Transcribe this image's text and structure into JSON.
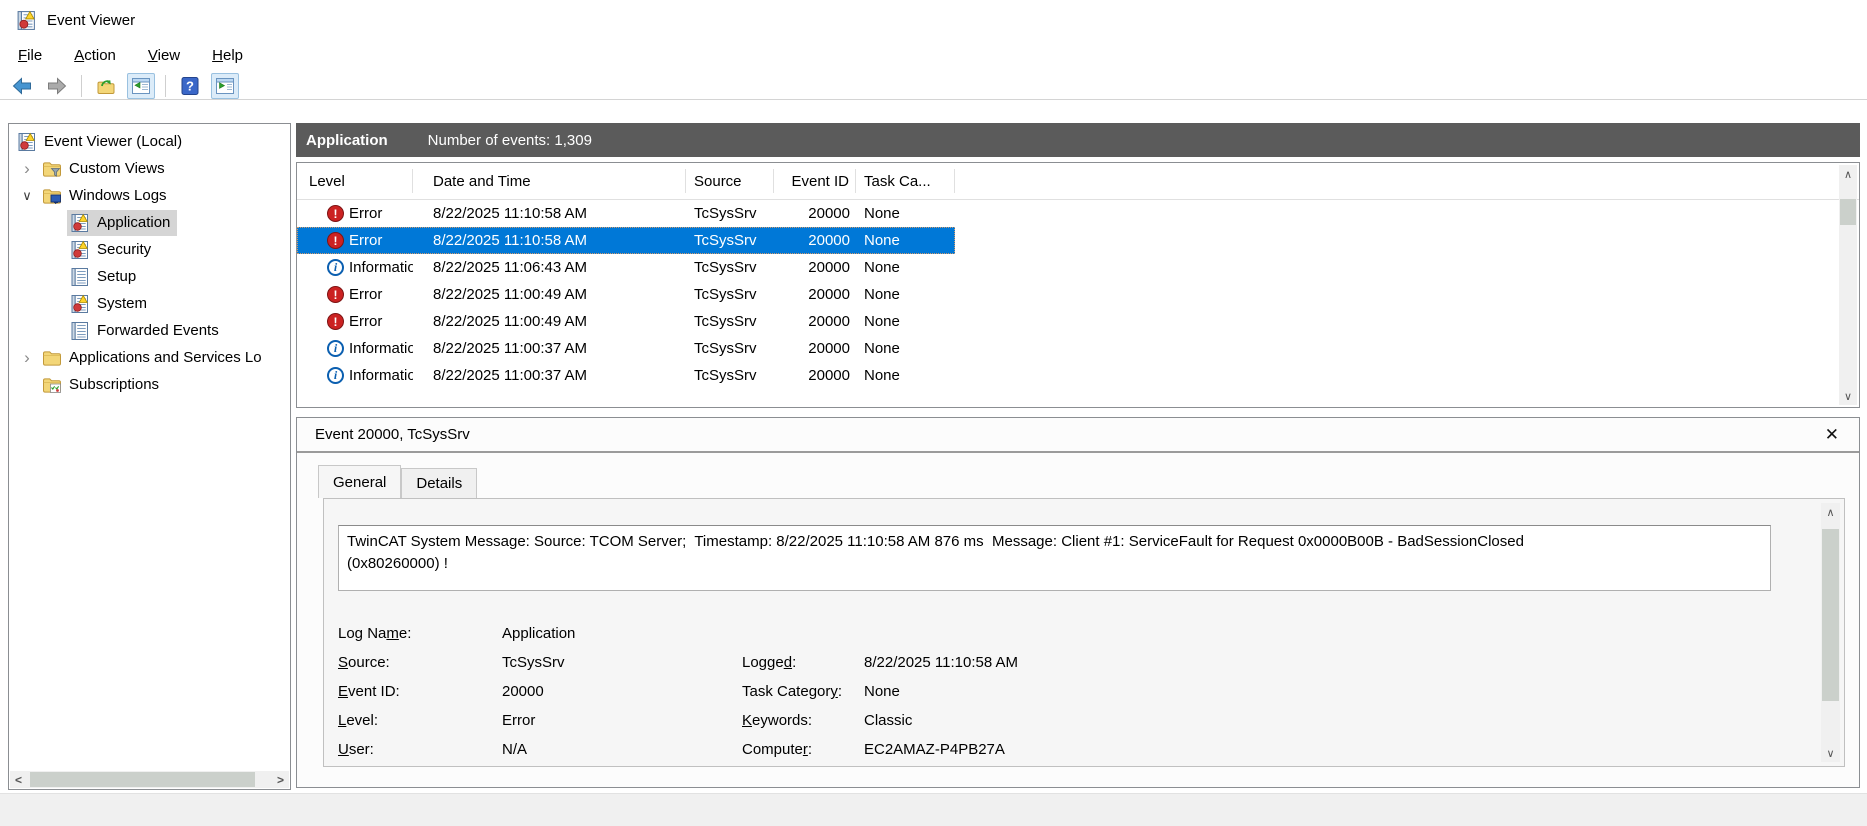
{
  "colors": {
    "selection_blue": "#0078d7",
    "pane_header_gray": "#5b5b5b",
    "error_red": "#cb2222",
    "info_blue": "#0b5fb0"
  },
  "window": {
    "title": "Event Viewer"
  },
  "menu": {
    "items": [
      {
        "label": "[F]ile"
      },
      {
        "label": "[A]ction"
      },
      {
        "label": "[V]iew"
      },
      {
        "label": "[H]elp"
      }
    ]
  },
  "icons": {
    "close": "✕",
    "up": "∧",
    "down": "∨",
    "left": "<",
    "right": ">",
    "chevron_collapsed": "›",
    "chevron_expanded": "∨"
  },
  "sidebar": {
    "items": [
      {
        "label": "Event Viewer (Local)",
        "icon": "event-viewer",
        "expander": "none",
        "selected": false
      },
      {
        "label": "Custom Views",
        "icon": "folder-filter",
        "expander": "collapsed",
        "selected": false
      },
      {
        "label": "Windows Logs",
        "icon": "folder-monitor",
        "expander": "expanded",
        "selected": false
      },
      {
        "label": "Application",
        "icon": "log-badged",
        "expander": "none",
        "selected": true
      },
      {
        "label": "Security",
        "icon": "log-badged",
        "expander": "none",
        "selected": false
      },
      {
        "label": "Setup",
        "icon": "log-plain",
        "expander": "none",
        "selected": false
      },
      {
        "label": "System",
        "icon": "log-badged",
        "expander": "none",
        "selected": false
      },
      {
        "label": "Forwarded Events",
        "icon": "log-plain",
        "expander": "none",
        "selected": false
      },
      {
        "label": "Applications and Services Lo",
        "icon": "folder-plain",
        "expander": "collapsed",
        "selected": false
      },
      {
        "label": "Subscriptions",
        "icon": "folder-subscriptions",
        "expander": "none",
        "selected": false
      }
    ]
  },
  "main": {
    "header": {
      "title": "Application",
      "count": "Number of events: 1,309"
    },
    "table": {
      "columns": [
        "Level",
        "Date and Time",
        "Source",
        "Event ID",
        "Task Ca..."
      ],
      "rows": [
        {
          "level": "Error",
          "datetime": "8/22/2025 11:10:58 AM",
          "source": "TcSysSrv",
          "event_id": "20000",
          "task_category": "None",
          "selected": false
        },
        {
          "level": "Error",
          "datetime": "8/22/2025 11:10:58 AM",
          "source": "TcSysSrv",
          "event_id": "20000",
          "task_category": "None",
          "selected": true
        },
        {
          "level": "Information",
          "datetime": "8/22/2025 11:06:43 AM",
          "source": "TcSysSrv",
          "event_id": "20000",
          "task_category": "None",
          "selected": false
        },
        {
          "level": "Error",
          "datetime": "8/22/2025 11:00:49 AM",
          "source": "TcSysSrv",
          "event_id": "20000",
          "task_category": "None",
          "selected": false
        },
        {
          "level": "Error",
          "datetime": "8/22/2025 11:00:49 AM",
          "source": "TcSysSrv",
          "event_id": "20000",
          "task_category": "None",
          "selected": false
        },
        {
          "level": "Information",
          "datetime": "8/22/2025 11:00:37 AM",
          "source": "TcSysSrv",
          "event_id": "20000",
          "task_category": "None",
          "selected": false
        },
        {
          "level": "Information",
          "datetime": "8/22/2025 11:00:37 AM",
          "source": "TcSysSrv",
          "event_id": "20000",
          "task_category": "None",
          "selected": false
        }
      ]
    }
  },
  "details": {
    "title": "Event 20000, TcSysSrv",
    "tabs": [
      {
        "label": "General",
        "active": true
      },
      {
        "label": "Details",
        "active": false
      }
    ],
    "message_lines": [
      "TwinCAT System Message: Source: TCOM Server;  Timestamp: 8/22/2025 11:10:58 AM 876 ms  Message: Client #1: ServiceFault for Request 0x0000B00B - BadSessionClosed",
      "(0x80260000) !"
    ],
    "fields": {
      "log_name": {
        "label": "Log Na[m]e:",
        "value": "Application"
      },
      "source": {
        "label": "[S]ource:",
        "value": "TcSysSrv"
      },
      "event_id": {
        "label": "[E]vent ID:",
        "value": "20000"
      },
      "level": {
        "label": "[L]evel:",
        "value": "Error"
      },
      "user": {
        "label": "[U]ser:",
        "value": "N/A"
      },
      "logged": {
        "label": "Logge[d]:",
        "value": "8/22/2025 11:10:58 AM"
      },
      "task_category": {
        "label": "Task Categor[y]:",
        "value": "None"
      },
      "keywords": {
        "label": "[K]eywords:",
        "value": "Classic"
      },
      "computer": {
        "label": "Compute[r]:",
        "value": "EC2AMAZ-P4PB27A"
      }
    }
  }
}
